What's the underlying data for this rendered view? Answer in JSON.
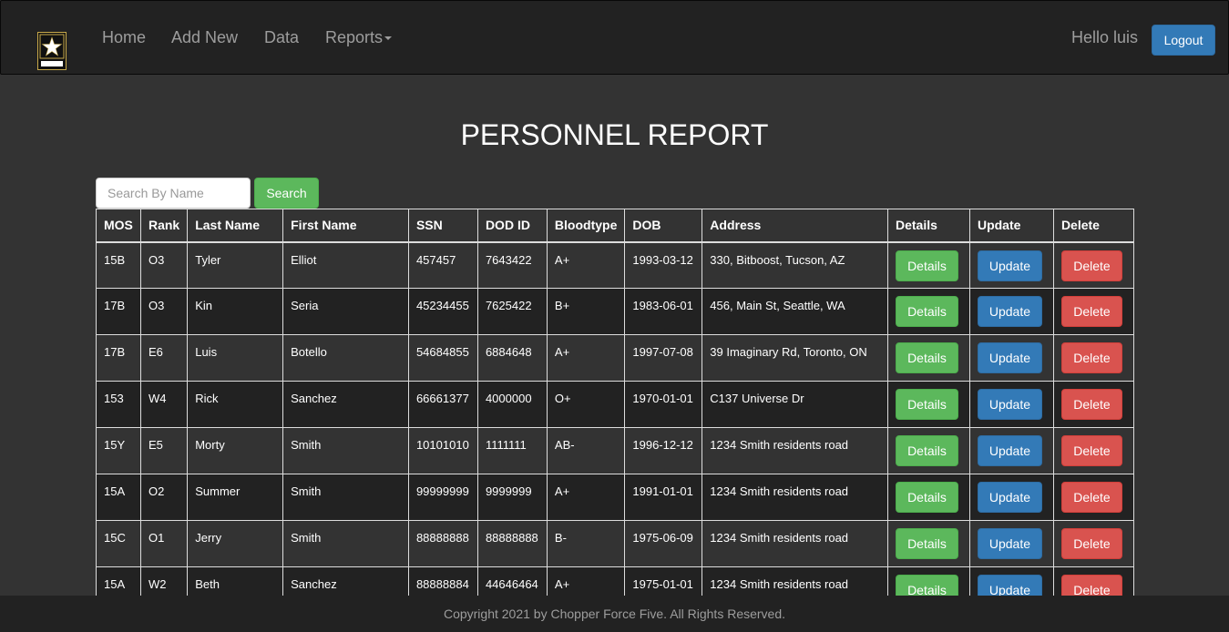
{
  "navbar": {
    "logo_text": "U.S. ARMY",
    "links": [
      {
        "label": "Home"
      },
      {
        "label": "Add New"
      },
      {
        "label": "Data"
      },
      {
        "label": "Reports"
      }
    ],
    "greeting": "Hello luis",
    "logout_label": "Logout"
  },
  "page_title": "PERSONNEL REPORT",
  "search": {
    "placeholder": "Search By Name",
    "value": "",
    "button_label": "Search"
  },
  "table": {
    "headers": [
      "MOS",
      "Rank",
      "Last Name",
      "First Name",
      "SSN",
      "DOD ID",
      "Bloodtype",
      "DOB",
      "Address",
      "Details",
      "Update",
      "Delete"
    ],
    "action_labels": {
      "details": "Details",
      "update": "Update",
      "delete": "Delete"
    },
    "rows": [
      {
        "mos": "15B",
        "rank": "O3",
        "last": "Tyler",
        "first": "Elliot",
        "ssn": "457457",
        "dod": "7643422",
        "blood": "A+",
        "dob": "1993-03-12",
        "address": "330, Bitboost, Tucson, AZ"
      },
      {
        "mos": "17B",
        "rank": "O3",
        "last": "Kin",
        "first": "Seria",
        "ssn": "45234455",
        "dod": "7625422",
        "blood": "B+",
        "dob": "1983-06-01",
        "address": "456, Main St, Seattle, WA"
      },
      {
        "mos": "17B",
        "rank": "E6",
        "last": "Luis",
        "first": "Botello",
        "ssn": "54684855",
        "dod": "6884648",
        "blood": "A+",
        "dob": "1997-07-08",
        "address": "39 Imaginary Rd, Toronto, ON"
      },
      {
        "mos": "153",
        "rank": "W4",
        "last": "Rick",
        "first": "Sanchez",
        "ssn": "66661377",
        "dod": "4000000",
        "blood": "O+",
        "dob": "1970-01-01",
        "address": "C137 Universe Dr"
      },
      {
        "mos": "15Y",
        "rank": "E5",
        "last": "Morty",
        "first": "Smith",
        "ssn": "10101010",
        "dod": "1111111",
        "blood": "AB-",
        "dob": "1996-12-12",
        "address": "1234 Smith residents road"
      },
      {
        "mos": "15A",
        "rank": "O2",
        "last": "Summer",
        "first": "Smith",
        "ssn": "99999999",
        "dod": "9999999",
        "blood": "A+",
        "dob": "1991-01-01",
        "address": "1234 Smith residents road"
      },
      {
        "mos": "15C",
        "rank": "O1",
        "last": "Jerry",
        "first": "Smith",
        "ssn": "88888888",
        "dod": "88888888",
        "blood": "B-",
        "dob": "1975-06-09",
        "address": "1234 Smith residents road"
      },
      {
        "mos": "15A",
        "rank": "W2",
        "last": "Beth",
        "first": "Sanchez",
        "ssn": "88888884",
        "dod": "44646464",
        "blood": "A+",
        "dob": "1975-01-01",
        "address": "1234 Smith residents road"
      }
    ]
  },
  "footer": {
    "text": "Copyright 2021 by Chopper Force Five. All Rights Reserved."
  },
  "colors": {
    "navbar_bg": "#222222",
    "page_bg": "#333333",
    "primary": "#337ab7",
    "success": "#5cb85c",
    "danger": "#d9534f"
  }
}
